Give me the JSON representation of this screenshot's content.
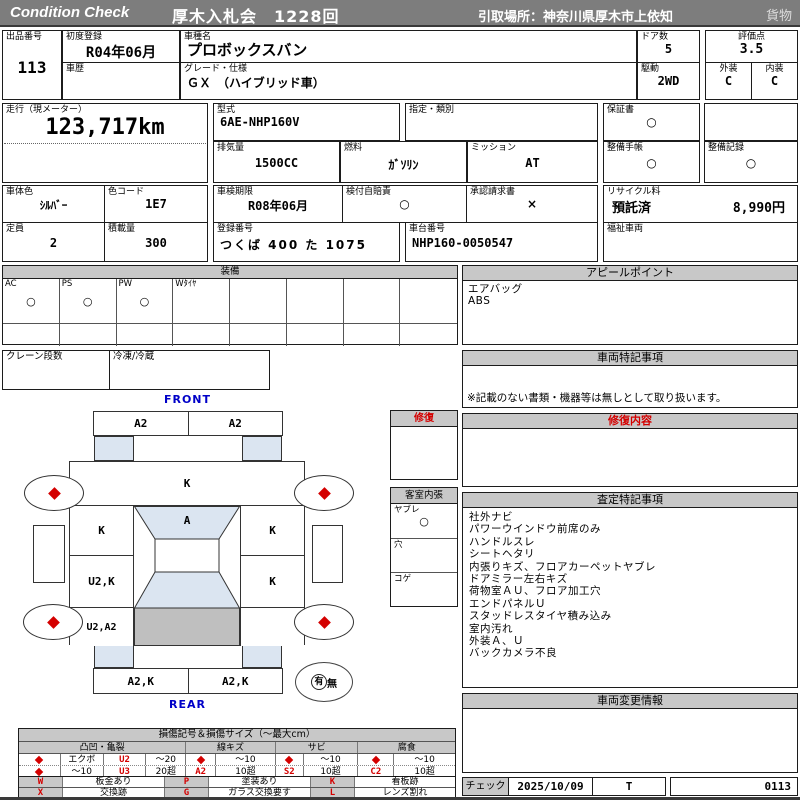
{
  "header": {
    "brand": "Condition  Check",
    "auction_title": "厚木入札会　1228回",
    "pickup_place": "引取場所：神奈川県厚木市上依知",
    "cargo_tag": "貨物"
  },
  "fields": {
    "lot": {
      "label": "出品番号",
      "value": "113"
    },
    "first_reg": {
      "label": "初度登録",
      "value": "R04年06月"
    },
    "history": {
      "label": "車歴",
      "value": ""
    },
    "model_name": {
      "label": "車種名",
      "value": "プロボックスバン"
    },
    "grade": {
      "label": "グレード・仕様",
      "value": "ＧＸ　（ハイブリッド車）"
    },
    "doors": {
      "label": "ドア数",
      "value": "5"
    },
    "score": {
      "label": "評価点",
      "value": "3.5"
    },
    "drive": {
      "label": "駆動",
      "value": "2WD"
    },
    "exterior": {
      "label": "外装",
      "value": "C"
    },
    "interior": {
      "label": "内装",
      "value": "C"
    },
    "mileage": {
      "label": "走行（現メーター）",
      "value": "123,717km"
    },
    "model_code": {
      "label": "型式",
      "value": "6AE-NHP160V"
    },
    "designation": {
      "label": "指定・類別",
      "value": ""
    },
    "displacement": {
      "label": "排気量",
      "value": "1500CC"
    },
    "fuel": {
      "label": "燃料",
      "value": "ｶﾞｿﾘﾝ"
    },
    "mission": {
      "label": "ミッション",
      "value": "AT"
    },
    "warranty": {
      "label": "保証書",
      "value": "○"
    },
    "maintenance_book": {
      "label": "整備手帳",
      "value": "○"
    },
    "maintenance_record": {
      "label": "整備記録",
      "value": "○"
    },
    "body_color": {
      "label": "車体色",
      "value": "ｼﾙﾊﾞｰ"
    },
    "color_code": {
      "label": "色コード",
      "value": "1E7"
    },
    "capacity": {
      "label": "定員",
      "value": "2"
    },
    "load": {
      "label": "積載量",
      "value": "300"
    },
    "inspection_expiry": {
      "label": "車検期限",
      "value": "R08年06月"
    },
    "insurance": {
      "label": "検付自賠責",
      "value": "○"
    },
    "approval_request": {
      "label": "承認請求書",
      "value": "×"
    },
    "registration_no": {
      "label": "登録番号",
      "value": "つくば 400 た 1075"
    },
    "chassis_no": {
      "label": "車台番号",
      "value": "NHP160-0050547"
    },
    "recycle": {
      "label": "リサイクル料",
      "status": "預託済",
      "fee": "8,990円"
    },
    "welfare": {
      "label": "福祉車両",
      "value": ""
    },
    "crane": {
      "label": "クレーン段数",
      "value": ""
    },
    "reefer": {
      "label": "冷凍/冷蔵",
      "value": ""
    }
  },
  "equipment": {
    "title": "装備",
    "items": [
      {
        "label": "AC",
        "value": "○"
      },
      {
        "label": "PS",
        "value": "○"
      },
      {
        "label": "PW",
        "value": "○"
      },
      {
        "label": "Wﾀｲﾔ",
        "value": ""
      },
      {
        "label": "",
        "value": ""
      },
      {
        "label": "",
        "value": ""
      },
      {
        "label": "",
        "value": ""
      },
      {
        "label": "",
        "value": ""
      }
    ]
  },
  "diagram": {
    "front_label": "FRONT",
    "rear_label": "REAR",
    "front_bumper": [
      "A2",
      "A2"
    ],
    "hood": "K",
    "roof": "A",
    "left_side": [
      "K",
      "U2,K",
      "U2,A2"
    ],
    "right_side": [
      "K",
      "K",
      ""
    ],
    "rear_bumper": [
      "A2,K",
      "A2,K"
    ],
    "spare_yes": "有",
    "spare_no": "無"
  },
  "repair_box": {
    "title": "修復"
  },
  "cabin": {
    "title": "客室内張",
    "rows": [
      {
        "label": "ヤブレ",
        "value": "○"
      },
      {
        "label": "穴",
        "value": ""
      },
      {
        "label": "コゲ",
        "value": ""
      }
    ]
  },
  "right": {
    "appeal": {
      "title": "アピールポイント",
      "lines": [
        "エアバッグ",
        "ABS"
      ]
    },
    "vehicle_notes": {
      "title": "車両特記事項",
      "note": "※記載のない書類・機器等は無しとして取り扱います。"
    },
    "repair_content": {
      "title": "修復内容"
    },
    "assessment": {
      "title": "査定特記事項",
      "lines": [
        "社外ナビ",
        "パワーウインドウ前席のみ",
        "ハンドルスレ",
        "シートヘタリ",
        "内張りキズ、フロアカーペットヤブレ",
        "ドアミラー左右キズ",
        "荷物室ＡＵ、フロア加工穴",
        "エンドパネルＵ",
        "スタッドレスタイヤ積み込み",
        "室内汚れ",
        "外装Ａ、Ｕ",
        "バックカメラ不良"
      ]
    },
    "change_info": {
      "title": "車両変更情報"
    },
    "check": {
      "label": "チェック",
      "date": "2025/10/09",
      "inspector": "T",
      "code": "0113"
    }
  },
  "legend": {
    "title": "損傷記号＆損傷サイズ（～最大cm）",
    "categories": [
      "凸凹・亀裂",
      "線キズ",
      "サビ",
      "腐食"
    ],
    "dent": {
      "r1_name": "エクボ",
      "r1_code": "U2",
      "r1_size": "～20",
      "r2_name": "～10",
      "r2_code": "U3",
      "r2_size": "20超"
    },
    "scratch": {
      "r1_size": "～10",
      "r2_code": "A2",
      "r2_size": "10超"
    },
    "rust": {
      "r1_size": "～10",
      "r2_code": "S2",
      "r2_size": "10超"
    },
    "corrosion": {
      "r1_size": "～10",
      "r2_code": "C2",
      "r2_size": "10超"
    },
    "codes": {
      "w": "W",
      "w_desc": "板金あり",
      "x": "X",
      "x_desc": "交換跡",
      "p": "P",
      "p_desc": "塗装あり",
      "g": "G",
      "g_desc": "ガラス交換要す",
      "k": "K",
      "k_desc": "看板跡",
      "l": "L",
      "l_desc": "レンズ割れ"
    }
  },
  "colors": {
    "header_bg": "#7d7d7d",
    "section_bg": "#c8c8c8",
    "alert_red": "#d40000",
    "diagram_blue": "#dbe5f1",
    "label_blue": "#0000c8"
  }
}
